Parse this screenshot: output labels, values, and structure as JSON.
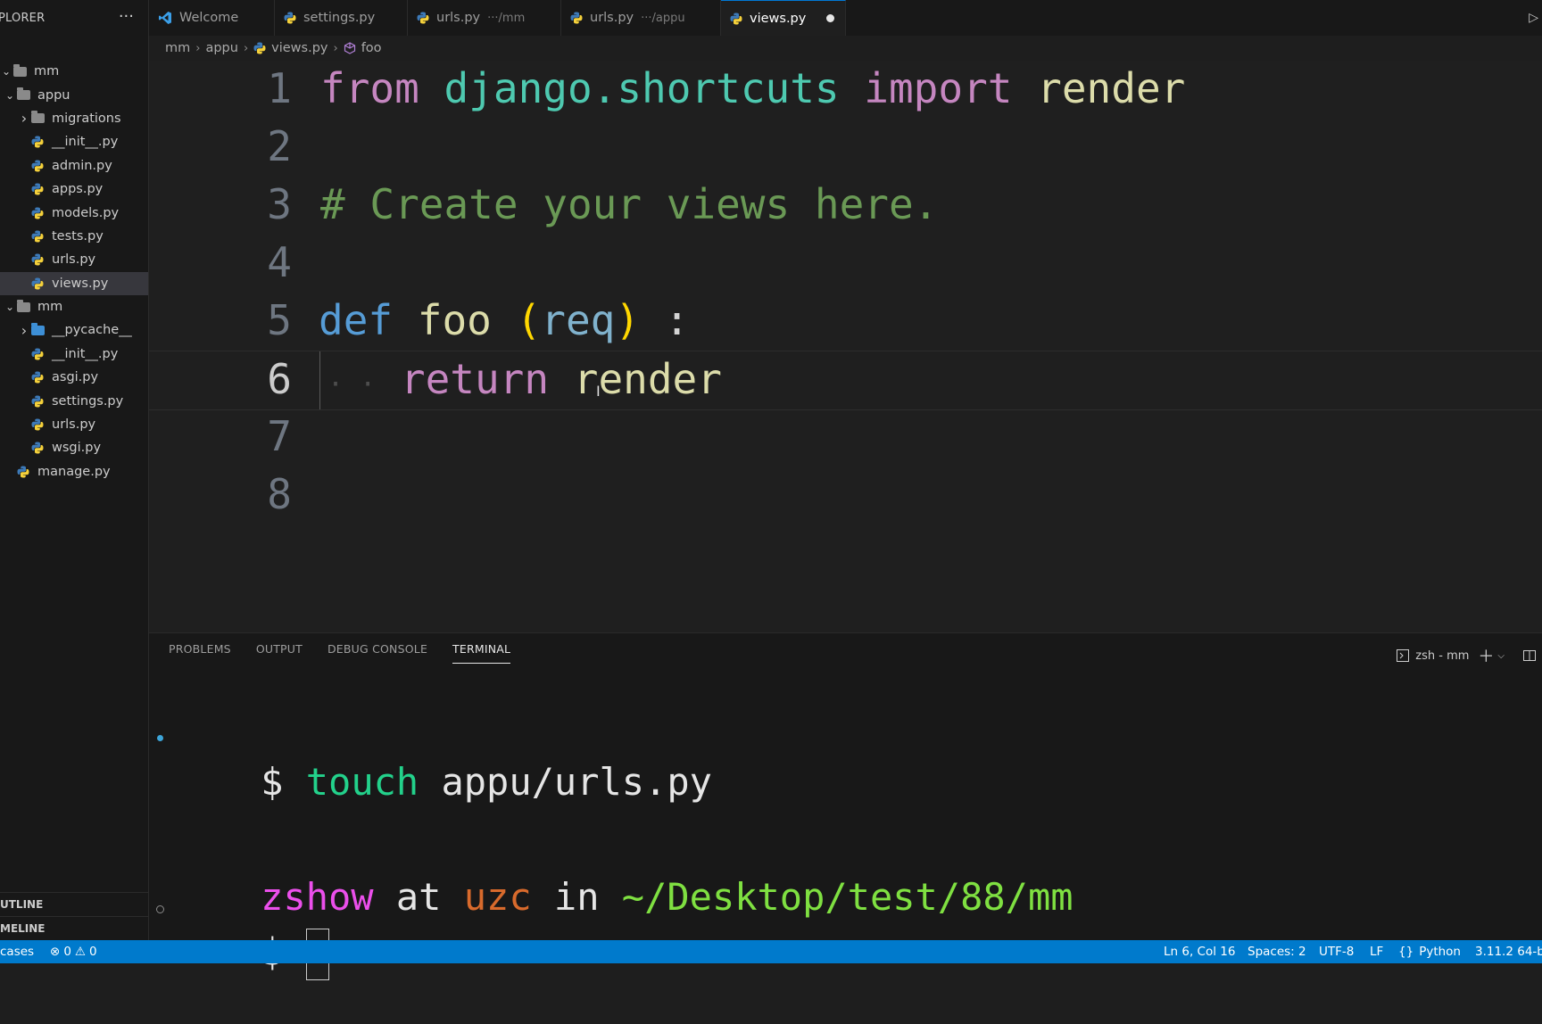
{
  "sidebar": {
    "title": "PLORER",
    "tree": [
      {
        "label": "mm",
        "type": "folder-open",
        "depth": 0
      },
      {
        "label": "appu",
        "type": "folder-open",
        "depth": 1
      },
      {
        "label": "migrations",
        "type": "folder-closed",
        "depth": 2
      },
      {
        "label": "__init__.py",
        "type": "python",
        "depth": 2
      },
      {
        "label": "admin.py",
        "type": "python",
        "depth": 2
      },
      {
        "label": "apps.py",
        "type": "python",
        "depth": 2
      },
      {
        "label": "models.py",
        "type": "python",
        "depth": 2
      },
      {
        "label": "tests.py",
        "type": "python",
        "depth": 2
      },
      {
        "label": "urls.py",
        "type": "python",
        "depth": 2
      },
      {
        "label": "views.py",
        "type": "python",
        "depth": 2,
        "selected": true
      },
      {
        "label": "mm",
        "type": "folder-open",
        "depth": 1
      },
      {
        "label": "__pycache__",
        "type": "folder-closed-blue",
        "depth": 2
      },
      {
        "label": "__init__.py",
        "type": "python",
        "depth": 2
      },
      {
        "label": "asgi.py",
        "type": "python",
        "depth": 2
      },
      {
        "label": "settings.py",
        "type": "python",
        "depth": 2
      },
      {
        "label": "urls.py",
        "type": "python",
        "depth": 2
      },
      {
        "label": "wsgi.py",
        "type": "python",
        "depth": 2
      },
      {
        "label": "manage.py",
        "type": "python",
        "depth": 1
      }
    ],
    "outline_label": "UTLINE",
    "timeline_label": "MELINE"
  },
  "tabs": [
    {
      "label": "Welcome",
      "hint": "",
      "icon": "vscode-icon"
    },
    {
      "label": "settings.py",
      "hint": "",
      "icon": "python-icon"
    },
    {
      "label": "urls.py",
      "hint": "···/mm",
      "icon": "python-icon"
    },
    {
      "label": "urls.py",
      "hint": "···/appu",
      "icon": "python-icon"
    },
    {
      "label": "views.py",
      "hint": "",
      "icon": "python-icon",
      "active": true,
      "dirty": true
    }
  ],
  "breadcrumb": {
    "part1": "mm",
    "part2": "appu",
    "part3": "views.py",
    "part4": "foo"
  },
  "editor": {
    "line_numbers": [
      "1",
      "2",
      "3",
      "4",
      "5",
      "6",
      "7",
      "8"
    ],
    "current_line": 6,
    "line1": {
      "from": "from",
      "module": "django.shortcuts",
      "import": "import",
      "name": "render"
    },
    "line3": {
      "comment": "# Create your views here."
    },
    "line5": {
      "def": "def",
      "fn": "foo",
      "lparen": "(",
      "param": "req",
      "rparen": ")",
      "colon": ":"
    },
    "line6": {
      "ws": "· ·",
      "return": "return",
      "name": "render"
    }
  },
  "panel": {
    "tabs": [
      "PROBLEMS",
      "OUTPUT",
      "DEBUG CONSOLE",
      "TERMINAL"
    ],
    "active_tab": "TERMINAL",
    "shell_label": "zsh - mm",
    "terminal": {
      "cmd_prompt": "$",
      "cmd": "touch",
      "cmd_arg": "appu/urls.py",
      "user": "zshow",
      "at": "at",
      "host": "uzc",
      "in": "in",
      "path": "~/Desktop/test/88/mm",
      "prompt2": "$"
    }
  },
  "statusbar": {
    "left_text": "cases",
    "errors": "0",
    "warnings": "0",
    "position": "Ln 6, Col 16",
    "spaces": "Spaces: 2",
    "encoding": "UTF-8",
    "eol": "LF",
    "language": "Python",
    "interpreter": "3.11.2 64-b"
  },
  "colors": {
    "accent": "#007acc",
    "keyword_control": "#c586c0",
    "keyword_storage": "#569cd6",
    "module": "#4ec9b0",
    "function": "#dcdcaa",
    "comment": "#6a9955",
    "terminal_green": "#23d18b"
  }
}
